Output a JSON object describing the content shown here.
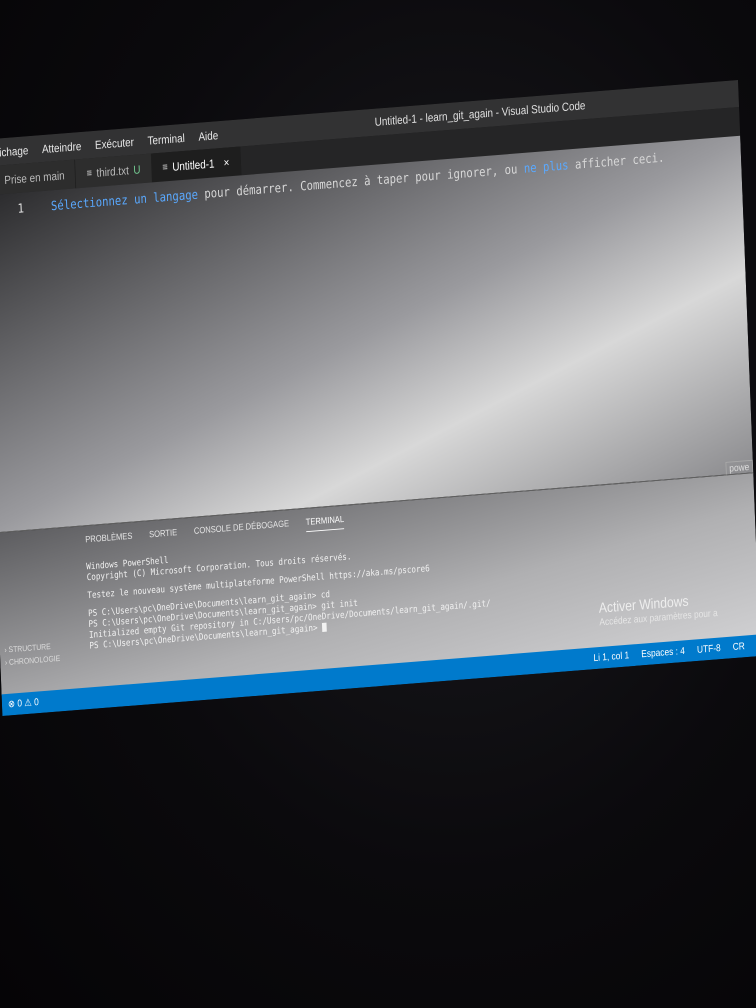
{
  "window": {
    "title": "Untitled-1 - learn_git_again - Visual Studio Code"
  },
  "menu": {
    "items": [
      "Affichage",
      "Atteindre",
      "Exécuter",
      "Terminal",
      "Aide"
    ]
  },
  "tabs": [
    {
      "label": "Prise en main",
      "icon": "vscode-logo-icon"
    },
    {
      "label": "third.txt",
      "badge": "U",
      "icon": "file-text-icon"
    },
    {
      "label": "Untitled-1",
      "icon": "file-text-icon",
      "close": "×"
    }
  ],
  "editor": {
    "line_number": "1",
    "hint_link": "Sélectionnez un langage",
    "hint_mid": " pour démarrer. Commencez à taper pour ignorer, ou ",
    "hint_link2": "ne plus",
    "hint_end": " afficher ceci."
  },
  "panel": {
    "tabs": [
      "PROBLÈMES",
      "SORTIE",
      "CONSOLE DE DÉBOGAGE",
      "TERMINAL"
    ],
    "active_tab": "TERMINAL",
    "ps_badge": "powe"
  },
  "terminal": {
    "lines": [
      "Windows PowerShell",
      "Copyright (C) Microsoft Corporation. Tous droits réservés.",
      "",
      "Testez le nouveau système multiplateforme PowerShell https://aka.ms/pscore6",
      "",
      "PS C:\\Users\\pc\\OneDrive\\Documents\\learn_git_again> cd",
      "PS C:\\Users\\pc\\OneDrive\\Documents\\learn_git_again> git init",
      "Initialized empty Git repository in C:/Users/pc/OneDrive/Documents/learn_git_again/.git/",
      "PS C:\\Users\\pc\\OneDrive\\Documents\\learn_git_again> "
    ]
  },
  "activation": {
    "title": "Activer Windows",
    "subtitle": "Accédez aux paramètres pour a"
  },
  "sidebar_outline": {
    "items": [
      "STRUCTURE",
      "CHRONOLOGIE"
    ]
  },
  "statusbar": {
    "left": "⊗ 0 ⚠ 0",
    "position": "Li 1, col 1",
    "spaces": "Espaces : 4",
    "encoding": "UTF-8",
    "eol": "CR"
  },
  "colors": {
    "statusbar": "#007acc",
    "link": "#5aa9ff",
    "editor_bg": "#1e1e1e"
  }
}
